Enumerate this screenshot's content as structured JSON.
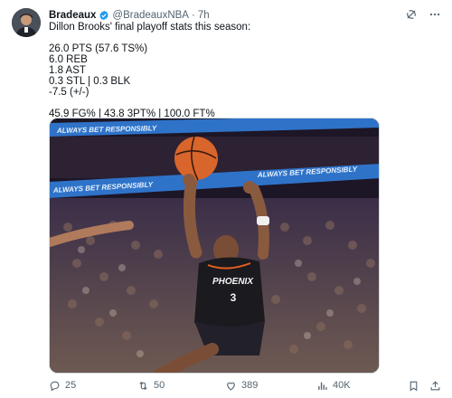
{
  "author": {
    "display_name": "Bradeaux",
    "handle": "@BradeauxNBA",
    "separator": "·",
    "time": "7h"
  },
  "tweet": {
    "intro": "Dillon Brooks' final playoff stats this season:",
    "stats": [
      "26.0 PTS (57.6 TS%)",
      "6.0 REB",
      "1.8 AST",
      "0.3 STL | 0.3 BLK",
      "-7.5 (+/-)"
    ],
    "shooting": "45.9 FG% | 43.8 3PT% | 100.0 FT%"
  },
  "media": {
    "banner_text_1": "ALWAYS BET RESPONSIBLY",
    "banner_text_2": "ALWAYS BET RESPONSIBLY",
    "banner_text_3": "ALWAYS BET RESPONSIBLY",
    "jersey_team": "PHOENIX",
    "jersey_number": "3"
  },
  "actions": {
    "replies": "25",
    "reposts": "50",
    "likes": "389",
    "views": "40K"
  },
  "colors": {
    "accent": "#1d9bf0",
    "secondary_text": "#536471",
    "primary_text": "#0f1419",
    "jersey": "#1a1a1f",
    "jersey_trim": "#e56020"
  },
  "icons": {
    "verified": "verified-badge-icon",
    "grok": "grok-icon",
    "more": "more-icon",
    "reply": "reply-icon",
    "repost": "repost-icon",
    "like": "like-icon",
    "views": "views-icon",
    "bookmark": "bookmark-icon",
    "share": "share-icon"
  }
}
